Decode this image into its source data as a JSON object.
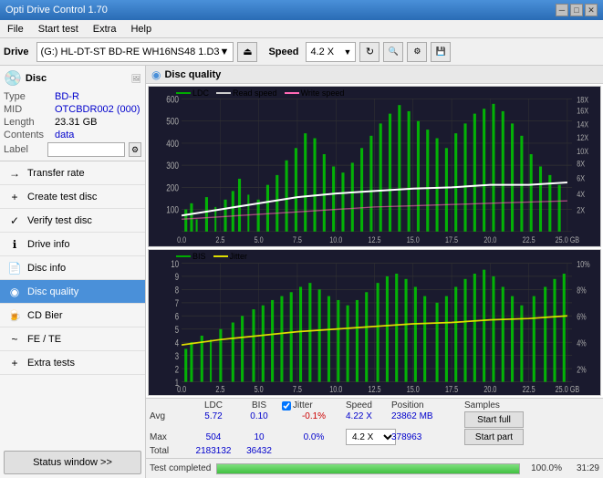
{
  "titleBar": {
    "title": "Opti Drive Control 1.70",
    "minimizeBtn": "─",
    "maximizeBtn": "□",
    "closeBtn": "✕"
  },
  "menuBar": {
    "items": [
      "File",
      "Start test",
      "Extra",
      "Help"
    ]
  },
  "driveBar": {
    "driveLabel": "Drive",
    "driveValue": "(G:)  HL-DT-ST BD-RE  WH16NS48 1.D3",
    "speedLabel": "Speed",
    "speedValue": "4.2 X"
  },
  "disc": {
    "title": "Disc",
    "typeLabel": "Type",
    "typeValue": "BD-R",
    "midLabel": "MID",
    "midValue": "OTCBDR002 (000)",
    "lengthLabel": "Length",
    "lengthValue": "23.31 GB",
    "contentsLabel": "Contents",
    "contentsValue": "data",
    "labelLabel": "Label",
    "labelValue": ""
  },
  "navItems": [
    {
      "id": "transfer-rate",
      "label": "Transfer rate",
      "icon": "→"
    },
    {
      "id": "create-test-disc",
      "label": "Create test disc",
      "icon": "+"
    },
    {
      "id": "verify-test-disc",
      "label": "Verify test disc",
      "icon": "✓"
    },
    {
      "id": "drive-info",
      "label": "Drive info",
      "icon": "i"
    },
    {
      "id": "disc-info",
      "label": "Disc info",
      "icon": "📄"
    },
    {
      "id": "disc-quality",
      "label": "Disc quality",
      "icon": "★",
      "active": true
    },
    {
      "id": "cd-bier",
      "label": "CD Bier",
      "icon": "🍺"
    },
    {
      "id": "fe-te",
      "label": "FE / TE",
      "icon": "~"
    },
    {
      "id": "extra-tests",
      "label": "Extra tests",
      "icon": "+"
    }
  ],
  "statusBtn": "Status window >>",
  "chartHeader": {
    "title": "Disc quality",
    "icon": "◉"
  },
  "topChart": {
    "legend": [
      {
        "label": "LDC",
        "color": "#00aa00"
      },
      {
        "label": "Read speed",
        "color": "#ffffff"
      },
      {
        "label": "Write speed",
        "color": "#ff69b4"
      }
    ],
    "yMax": 600,
    "yLabels": [
      "600",
      "500",
      "400",
      "300",
      "200",
      "100"
    ],
    "yRight": [
      "18X",
      "16X",
      "14X",
      "12X",
      "10X",
      "8X",
      "6X",
      "4X",
      "2X"
    ],
    "xLabels": [
      "0.0",
      "2.5",
      "5.0",
      "7.5",
      "10.0",
      "12.5",
      "15.0",
      "17.5",
      "20.0",
      "22.5",
      "25.0 GB"
    ]
  },
  "bottomChart": {
    "legend": [
      {
        "label": "BIS",
        "color": "#00aa00"
      },
      {
        "label": "Jitter",
        "color": "#ffff00"
      }
    ],
    "yMax": 10,
    "yLabels": [
      "10",
      "9",
      "8",
      "7",
      "6",
      "5",
      "4",
      "3",
      "2",
      "1"
    ],
    "yRight": [
      "10%",
      "8%",
      "6%",
      "4%",
      "2%"
    ],
    "xLabels": [
      "0.0",
      "2.5",
      "5.0",
      "7.5",
      "10.0",
      "12.5",
      "15.0",
      "17.5",
      "20.0",
      "22.5",
      "25.0 GB"
    ]
  },
  "stats": {
    "ldcHeader": "LDC",
    "bisHeader": "BIS",
    "jitterHeader": "Jitter",
    "speedHeader": "Speed",
    "positionHeader": "Position",
    "samplesHeader": "Samples",
    "avgLabel": "Avg",
    "maxLabel": "Max",
    "totalLabel": "Total",
    "ldcAvg": "5.72",
    "ldcMax": "504",
    "ldcTotal": "2183132",
    "bisAvg": "0.10",
    "bisMax": "10",
    "bisTotal": "36432",
    "jitterAvg": "-0.1%",
    "jitterMax": "0.0%",
    "jitterChecked": true,
    "speedValue": "4.22 X",
    "speedDropdown": "4.2 X",
    "positionValue": "23862 MB",
    "samplesValue": "378963",
    "startFullBtn": "Start full",
    "startPartBtn": "Start part"
  },
  "progress": {
    "label": "Test completed",
    "percent": 100,
    "percentText": "100.0%",
    "time": "31:29"
  }
}
